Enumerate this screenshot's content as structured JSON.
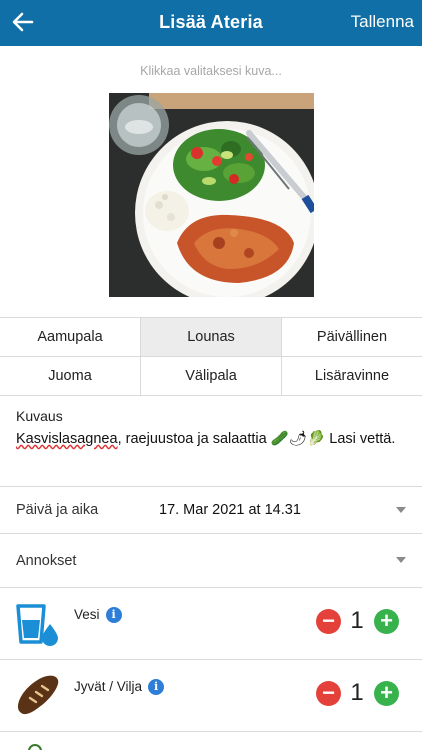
{
  "header": {
    "title": "Lisää Ateria",
    "save_label": "Tallenna"
  },
  "photo": {
    "hint": "Klikkaa valitaksesi kuva..."
  },
  "meal_types": [
    {
      "label": "Aamupala",
      "selected": false
    },
    {
      "label": "Lounas",
      "selected": true
    },
    {
      "label": "Päivällinen",
      "selected": false
    },
    {
      "label": "Juoma",
      "selected": false
    },
    {
      "label": "Välipala",
      "selected": false
    },
    {
      "label": "Lisäravinne",
      "selected": false
    }
  ],
  "description": {
    "label": "Kuvaus",
    "text_part1": "Kasvislasagnea",
    "text_part2": ", raejuustoa ja salaattia",
    "emojis": "🥒🌶🥬",
    "text_part3": "Lasi vettä."
  },
  "datetime": {
    "label": "Päivä ja aika",
    "value": "17. Mar 2021 at 14.31"
  },
  "portions": {
    "label": "Annokset"
  },
  "items": [
    {
      "name": "Vesi",
      "count": "1",
      "icon": "water-glass-icon"
    },
    {
      "name": "Jyvät / Vilja",
      "count": "1",
      "icon": "bread-icon"
    }
  ],
  "colors": {
    "accent": "#0f6fa6",
    "minus": "#e4413a",
    "plus": "#37b24d",
    "info": "#2e7ed8"
  },
  "info_glyph": "i",
  "minus_glyph": "−",
  "plus_glyph": "+"
}
